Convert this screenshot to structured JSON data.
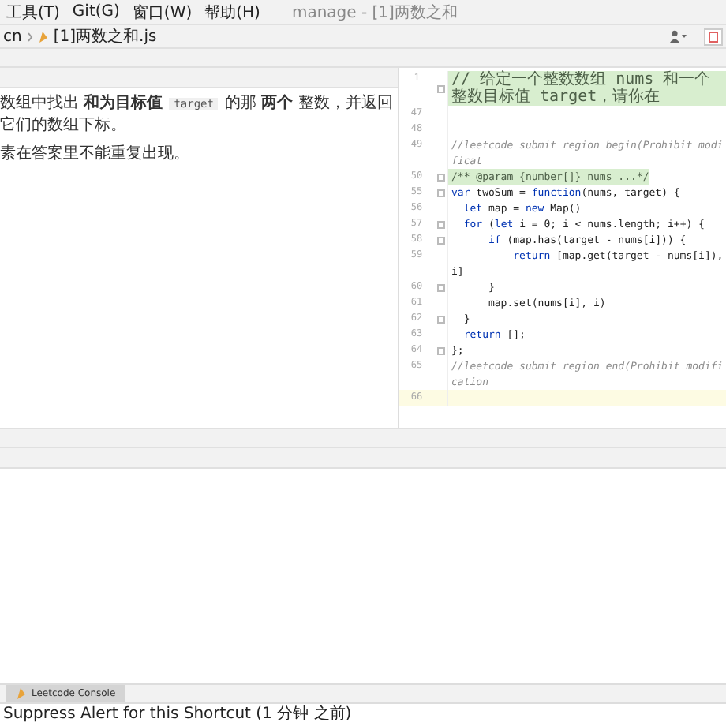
{
  "menu": [
    {
      "label": "工具(T)"
    },
    {
      "label": "Git(G)"
    },
    {
      "label": "窗口(W)"
    },
    {
      "label": "帮助(H)"
    }
  ],
  "window": {
    "title": "manage - [1]两数之和"
  },
  "breadcrumb": [
    {
      "label": "cn"
    },
    {
      "label": "[1]两数之和.js"
    }
  ],
  "description": [
    [
      {
        "kind": "text",
        "text": "数组中找出 **和为目标值**"
      },
      {
        "kind": "code",
        "text": "target"
      },
      {
        "kind": "text",
        "text": "的那 **两个** 整数，并返回它们的数组下标。"
      }
    ],
    [
      {
        "kind": "text",
        "text": "素在答案里不能重复出现。"
      }
    ]
  ],
  "editor": {
    "lines": [
      {
        "number": "1",
        "highlighted": true,
        "current": false,
        "fold": true,
        "tokens": [
          {
            "kind": "comment",
            "text": "// 给定一个整数数组 nums 和一个整数目标值 target，请你在"
          }
        ]
      },
      {
        "number": "47",
        "highlighted": false,
        "current": false,
        "fold": false
      },
      {
        "number": "48",
        "highlighted": false,
        "current": false,
        "fold": false
      },
      {
        "number": "49",
        "highlighted": false,
        "current": false,
        "fold": false,
        "tokens": [
          {
            "kind": "italic",
            "text": "//leetcode submit region begin(Prohibit modificat"
          }
        ]
      },
      {
        "number": "50",
        "highlighted": true,
        "current": false,
        "fold": true,
        "tokens": [
          {
            "kind": "comment",
            "text": "/** @param {number[]} nums ...*/"
          }
        ]
      },
      {
        "number": "55",
        "highlighted": false,
        "current": false,
        "fold": true,
        "tokens": [
          {
            "kind": "keyword",
            "text": "var"
          },
          {
            "kind": "plain",
            "text": " twoSum = "
          },
          {
            "kind": "keyword",
            "text": "function"
          },
          {
            "kind": "plain",
            "text": "(nums, target) {"
          }
        ]
      },
      {
        "number": "56",
        "highlighted": false,
        "current": false,
        "fold": false,
        "tokens": [
          {
            "kind": "keyword",
            "text": "  let"
          },
          {
            "kind": "plain",
            "text": " map = "
          },
          {
            "kind": "keyword",
            "text": "new"
          },
          {
            "kind": "plain",
            "text": " Map()"
          }
        ]
      },
      {
        "number": "57",
        "highlighted": false,
        "current": false,
        "fold": true,
        "tokens": [
          {
            "kind": "keyword",
            "text": "  for"
          },
          {
            "kind": "plain",
            "text": " ("
          },
          {
            "kind": "keyword",
            "text": "let"
          },
          {
            "kind": "plain",
            "text": " i = 0; i < nums.length; i++) {"
          }
        ]
      },
      {
        "number": "58",
        "highlighted": false,
        "current": false,
        "fold": true,
        "tokens": [
          {
            "kind": "keyword",
            "text": "      if"
          },
          {
            "kind": "plain",
            "text": " (map.has(target - nums[i])) {"
          }
        ]
      },
      {
        "number": "59",
        "highlighted": false,
        "current": false,
        "fold": false,
        "tokens": [
          {
            "kind": "keyword",
            "text": "          return"
          },
          {
            "kind": "plain",
            "text": " [map.get(target - nums[i]), i]"
          }
        ]
      },
      {
        "number": "60",
        "highlighted": false,
        "current": false,
        "fold": true,
        "tokens": [
          {
            "kind": "plain",
            "text": "      }"
          }
        ]
      },
      {
        "number": "61",
        "highlighted": false,
        "current": false,
        "fold": false,
        "tokens": [
          {
            "kind": "plain",
            "text": "      map.set(nums[i], i)"
          }
        ]
      },
      {
        "number": "62",
        "highlighted": false,
        "current": false,
        "fold": true,
        "tokens": [
          {
            "kind": "plain",
            "text": "  }"
          }
        ]
      },
      {
        "number": "63",
        "highlighted": false,
        "current": false,
        "fold": false,
        "tokens": [
          {
            "kind": "keyword",
            "text": "  return"
          },
          {
            "kind": "plain",
            "text": " [];"
          }
        ]
      },
      {
        "number": "64",
        "highlighted": false,
        "current": false,
        "fold": true,
        "tokens": [
          {
            "kind": "plain",
            "text": "};"
          }
        ]
      },
      {
        "number": "65",
        "highlighted": false,
        "current": false,
        "fold": false,
        "tokens": [
          {
            "kind": "italic",
            "text": "//leetcode submit region end(Prohibit modification"
          }
        ]
      },
      {
        "number": "66",
        "highlighted": false,
        "current": true,
        "fold": false
      }
    ]
  },
  "bottom_tabs": [
    {
      "label": "Leetcode Console",
      "selected": true
    }
  ],
  "status_bar": {
    "text": "Suppress Alert for this Shortcut (1 分钟 之前)"
  }
}
